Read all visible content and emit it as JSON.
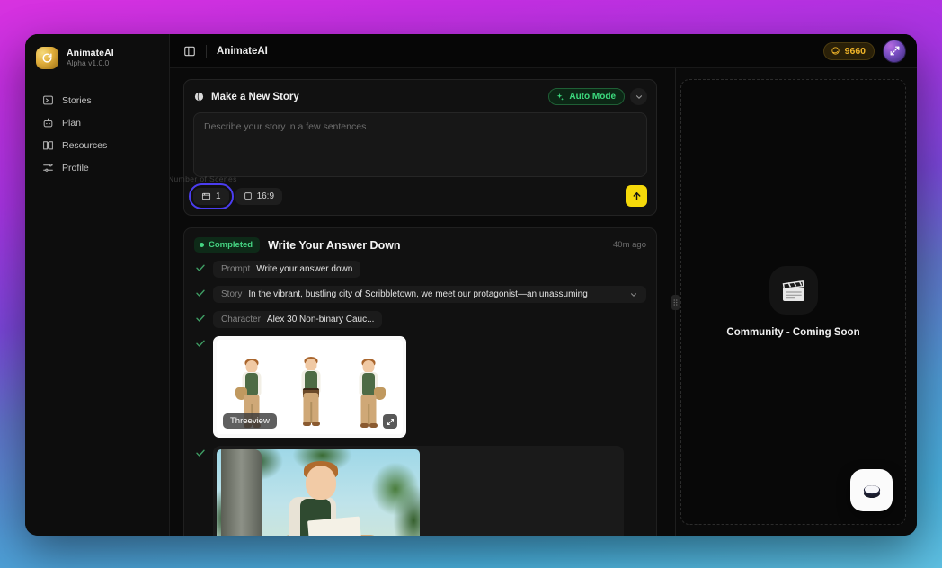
{
  "sidebar": {
    "brand": {
      "name": "AnimateAI",
      "version": "Alpha v1.0.0",
      "logo_icon": "refresh-logo-icon"
    },
    "items": [
      {
        "label": "Stories",
        "icon": "stories-icon"
      },
      {
        "label": "Plan",
        "icon": "robot-icon"
      },
      {
        "label": "Resources",
        "icon": "book-icon"
      },
      {
        "label": "Profile",
        "icon": "sliders-icon"
      }
    ]
  },
  "topbar": {
    "panel_toggle_icon": "panel-left-icon",
    "title": "AnimateAI",
    "credits": {
      "value": "9660",
      "icon": "coin-icon"
    },
    "avatar_icon": "expand-arrows-icon"
  },
  "new_story": {
    "title": "Make a New Story",
    "title_icon": "sphere-icon",
    "auto_mode_label": "Auto Mode",
    "auto_mode_icon": "sparkle-icon",
    "collapse_icon": "chevron-down-icon",
    "textarea_placeholder": "Describe your story in a few sentences",
    "textarea_value": "",
    "scenes_tooltip": "Number of Scenes",
    "scenes_value": "1",
    "scenes_icon": "film-icon",
    "aspect_value": "16:9",
    "aspect_icon": "frame-icon",
    "send_icon": "arrow-up-icon"
  },
  "completed_story": {
    "status_label": "Completed",
    "title": "Write Your Answer Down",
    "timestamp": "40m ago",
    "steps": [
      {
        "label": "Prompt",
        "value": "Write your answer down",
        "has_chevron": false,
        "wide": false
      },
      {
        "label": "Story",
        "value": "In the vibrant, bustling city of Scribbletown, we meet our protagonist—an unassuming",
        "has_chevron": true,
        "wide": true
      },
      {
        "label": "Character",
        "value": "Alex 30 Non-binary Cauc...",
        "has_chevron": false,
        "wide": false
      }
    ],
    "threeview": {
      "tag": "Threeview",
      "expand_icon": "expand-icon"
    },
    "scene": {
      "tag": "",
      "expand_icon": "expand-icon"
    }
  },
  "community": {
    "icon": "clapperboard-icon",
    "text": "Community - Coming Soon"
  },
  "fab": {
    "icon": "button-puck-icon"
  },
  "resize_handle": {
    "icon": "grip-icon"
  },
  "colors": {
    "accent_yellow": "#f5d90a",
    "accent_green": "#45d482",
    "credits_gold": "#f0b429",
    "focus_ring": "#4b3df0",
    "app_bg": "#0a0a0a"
  }
}
